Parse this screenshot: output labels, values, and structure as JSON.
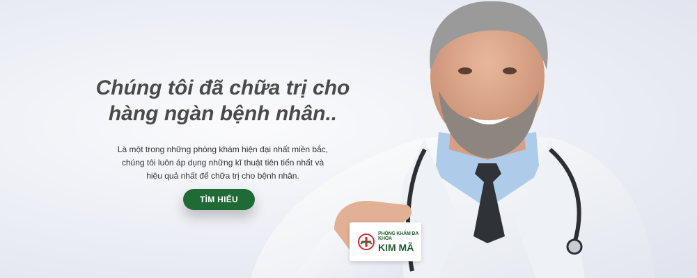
{
  "hero": {
    "headline_line1": "Chúng tôi đã chữa trị cho",
    "headline_line2": "hàng ngàn bệnh nhân..",
    "description": [
      "Là một trong những phòng khám hiện đại nhất miền bắc,",
      "chúng tôi luôn áp dụng những kĩ thuật tiên tiến nhất và",
      "hiệu quả nhất để chữa trị cho bệnh nhân."
    ],
    "cta_label": "TÌM HIỂU",
    "cta_color": "#1f6b35"
  },
  "card": {
    "clinic_type": "PHÒNG KHÁM ĐA KHOA",
    "clinic_name": "KIM MÃ",
    "brand_color": "#1e5d2e",
    "logo_icon": "medical-cross-logo-icon"
  },
  "image": {
    "subject": "doctor-photo"
  }
}
